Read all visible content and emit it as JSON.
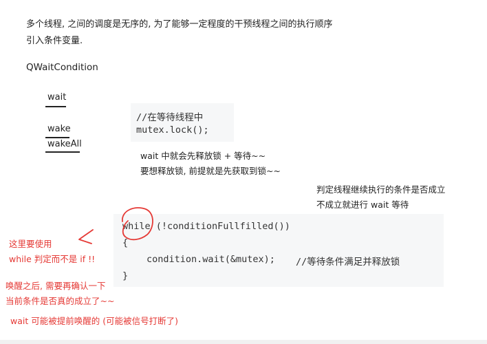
{
  "intro": {
    "line1": "多个线程, 之间的调度是无序的, 为了能够一定程度的干预线程之间的执行顺序",
    "line2": "引入条件变量."
  },
  "class_name": "QWaitCondition",
  "methods": [
    "wait",
    "wake",
    "wakeAll"
  ],
  "code1": {
    "comment": "//在等待线程中",
    "line": "mutex.lock();"
  },
  "note_lock": {
    "line1": "wait 中就会先释放锁 + 等待~~",
    "line2": "要想释放锁, 前提就是先获取到锁~~"
  },
  "note_loop": {
    "line1": "判定线程继续执行的条件是否成立",
    "line2": "不成立就进行 wait 等待"
  },
  "code2": {
    "while_kw": "while",
    "while_rest": " (!conditionFullfilled())",
    "open_brace": "{",
    "wait_call": "condition.wait(&mutex);",
    "wait_comment": "//等待条件满足并释放锁",
    "close_brace": "}"
  },
  "red_notes": {
    "use1": "这里要使用",
    "use2": "while 判定而不是 if !!",
    "wake1": "唤醒之后, 需要再确认一下",
    "wake2": "当前条件是否真的成立了~~",
    "early": "wait 可能被提前唤醒的 (可能被信号打断了)"
  },
  "colors": {
    "annotation": "#e53935",
    "code_bg": "#f6f7f8",
    "text": "#222222"
  }
}
